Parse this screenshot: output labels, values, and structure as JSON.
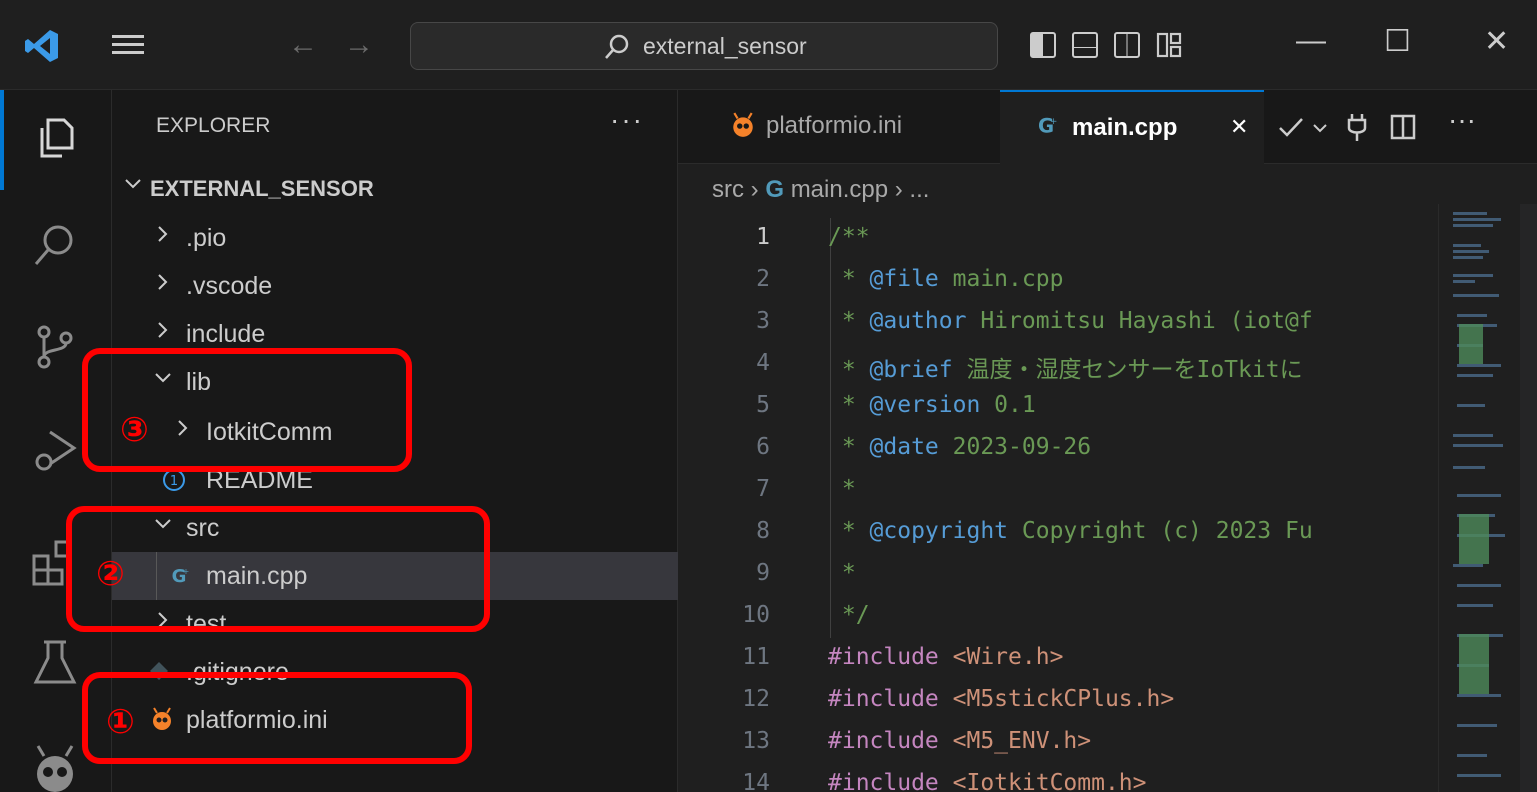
{
  "titlebar": {
    "search_text": "external_sensor",
    "back_arrow": "←",
    "forward_arrow": "→",
    "minimize": "—",
    "maximize": "☐",
    "close": "✕"
  },
  "explorer": {
    "header": "EXPLORER",
    "more": "···",
    "root": "EXTERNAL_SENSOR",
    "items": [
      {
        "label": ".pio"
      },
      {
        "label": ".vscode"
      },
      {
        "label": "include"
      },
      {
        "label": "lib"
      },
      {
        "label": "IotkitComm"
      },
      {
        "label": "README"
      },
      {
        "label": "src"
      },
      {
        "label": "main.cpp"
      },
      {
        "label": "test"
      },
      {
        "label": ".gitignore"
      },
      {
        "label": "platformio.ini"
      }
    ]
  },
  "tabs": [
    {
      "label": "platformio.ini"
    },
    {
      "label": "main.cpp",
      "close": "✕"
    }
  ],
  "tab_actions": {
    "more": "···"
  },
  "breadcrumb": {
    "folder": "src",
    "file": "main.cpp",
    "more": "..."
  },
  "code": {
    "lines": [
      {
        "n": "1",
        "parts": [
          [
            "c-com",
            "/**"
          ]
        ]
      },
      {
        "n": "2",
        "parts": [
          [
            "c-com",
            " * "
          ],
          [
            "c-tag",
            "@file"
          ],
          [
            "c-com",
            " main.cpp"
          ]
        ]
      },
      {
        "n": "3",
        "parts": [
          [
            "c-com",
            " * "
          ],
          [
            "c-tag",
            "@author"
          ],
          [
            "c-com",
            " Hiromitsu Hayashi (iot@f"
          ]
        ]
      },
      {
        "n": "4",
        "parts": [
          [
            "c-com",
            " * "
          ],
          [
            "c-tag",
            "@brief"
          ],
          [
            "c-com",
            " 温度・湿度センサーをIoTkitに"
          ]
        ]
      },
      {
        "n": "5",
        "parts": [
          [
            "c-com",
            " * "
          ],
          [
            "c-tag",
            "@version"
          ],
          [
            "c-com",
            " 0.1"
          ]
        ]
      },
      {
        "n": "6",
        "parts": [
          [
            "c-com",
            " * "
          ],
          [
            "c-tag",
            "@date"
          ],
          [
            "c-com",
            " 2023-09-26"
          ]
        ]
      },
      {
        "n": "7",
        "parts": [
          [
            "c-com",
            " *"
          ]
        ]
      },
      {
        "n": "8",
        "parts": [
          [
            "c-com",
            " * "
          ],
          [
            "c-tag",
            "@copyright"
          ],
          [
            "c-com",
            " Copyright (c) 2023 Fu"
          ]
        ]
      },
      {
        "n": "9",
        "parts": [
          [
            "c-com",
            " *"
          ]
        ]
      },
      {
        "n": "10",
        "parts": [
          [
            "c-com",
            " */"
          ]
        ]
      },
      {
        "n": "11",
        "parts": [
          [
            "c-kw",
            "#include"
          ],
          [
            "",
            " "
          ],
          [
            "c-str",
            "<Wire.h>"
          ]
        ]
      },
      {
        "n": "12",
        "parts": [
          [
            "c-kw",
            "#include"
          ],
          [
            "",
            " "
          ],
          [
            "c-str",
            "<M5stickCPlus.h>"
          ]
        ]
      },
      {
        "n": "13",
        "parts": [
          [
            "c-kw",
            "#include"
          ],
          [
            "",
            " "
          ],
          [
            "c-str",
            "<M5_ENV.h>"
          ]
        ]
      },
      {
        "n": "14",
        "parts": [
          [
            "c-kw",
            "#include"
          ],
          [
            "",
            " "
          ],
          [
            "c-str",
            "<IotkitComm.h>"
          ]
        ]
      }
    ]
  },
  "annotations": [
    {
      "num": "①"
    },
    {
      "num": "②"
    },
    {
      "num": "③"
    }
  ],
  "colors": {
    "accent": "#0078d4",
    "annotation": "#ff0000",
    "platformio": "#f5822a"
  }
}
